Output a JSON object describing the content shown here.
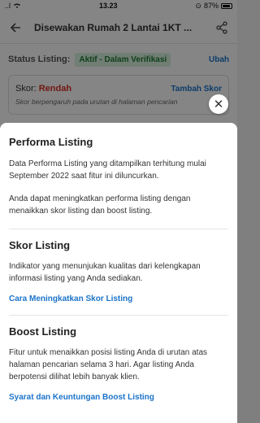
{
  "status_bar": {
    "signal": "..l",
    "time": "13.23",
    "battery": "87%"
  },
  "header": {
    "title": "Disewakan Rumah 2 Lantai 1KT ...",
    "back_icon": "arrow-left-icon",
    "share_icon": "share-icon"
  },
  "listing_status": {
    "label": "Status Listing:",
    "badge": "Aktif - Dalam Verifikasi",
    "link": "Ubah"
  },
  "score_card": {
    "label": "Skor: ",
    "value": "Rendah",
    "add_link": "Tambah Skor",
    "description": "Skor berpengaruh pada urutan di halaman pencarian"
  },
  "sheet": {
    "title": "Performa Listing",
    "para1": "Data Performa Listing yang ditampilkan terhitung mulai September 2022 saat fitur ini diluncurkan.",
    "para2": "Anda dapat meningkatkan performa listing dengan menaikkan skor listing dan boost listing.",
    "skor": {
      "title": "Skor Listing",
      "body": "Indikator yang menunjukan kualitas dari kelengkapan informasi listing yang Anda sediakan.",
      "link": "Cara Meningkatkan Skor Listing"
    },
    "boost": {
      "title": "Boost Listing",
      "body": "Fitur untuk menaikkan posisi listing Anda di urutan atas halaman pencarian selama 3 hari. Agar listing Anda berpotensi dilihat lebih banyak klien.",
      "link": "Syarat dan Keuntungan Boost Listing"
    },
    "close_icon": "close-icon"
  }
}
